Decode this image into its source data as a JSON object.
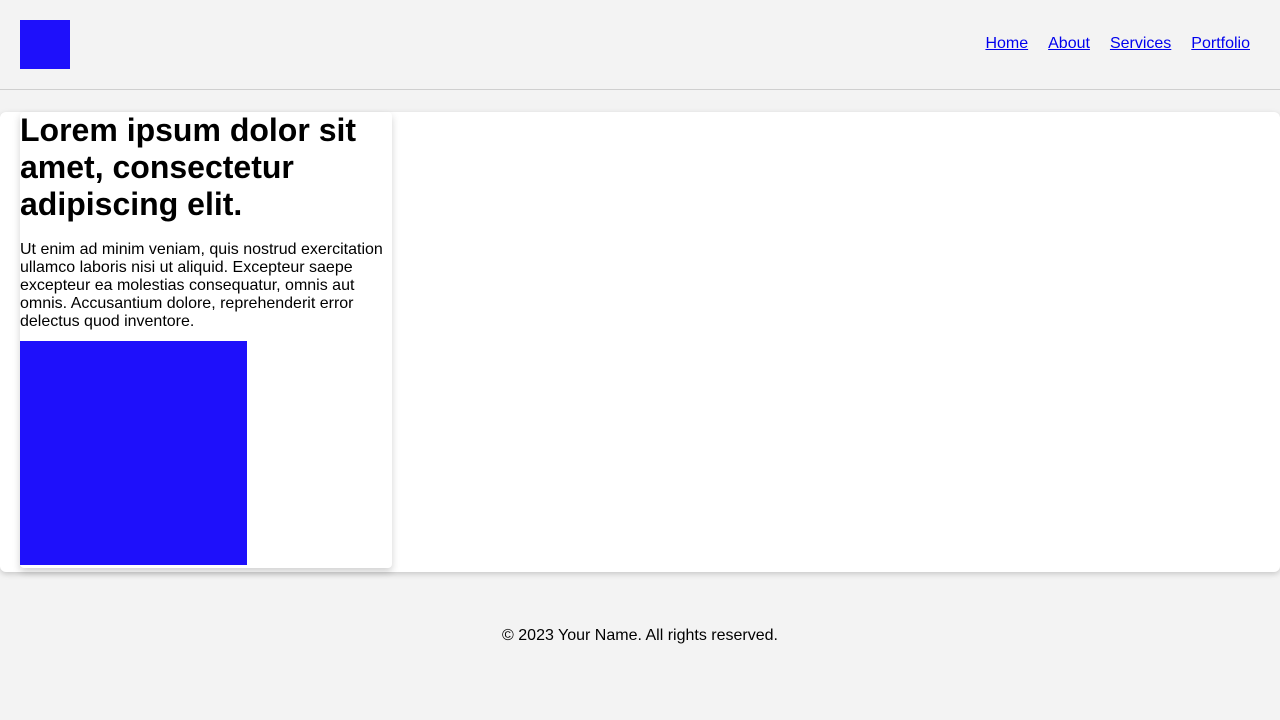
{
  "header": {
    "logo_color": "#1e10fb",
    "nav": [
      {
        "label": "Home"
      },
      {
        "label": "About"
      },
      {
        "label": "Services"
      },
      {
        "label": "Portfolio"
      }
    ]
  },
  "main": {
    "heading": "Lorem ipsum dolor sit amet, consectetur adipiscing elit.",
    "paragraph": "Ut enim ad minim veniam, quis nostrud exercitation ullamco laboris nisi ut aliquid. Excepteur saepe excepteur ea molestias consequatur, omnis aut omnis. Accusantium dolore, reprehenderit error delectus quod inventore.",
    "image_color": "#1e10fb"
  },
  "footer": {
    "text": "© 2023 Your Name. All rights reserved."
  },
  "colors": {
    "page_background": "#f3f3f3",
    "link": "#0000ee",
    "accent_blue": "#1e10fb"
  }
}
